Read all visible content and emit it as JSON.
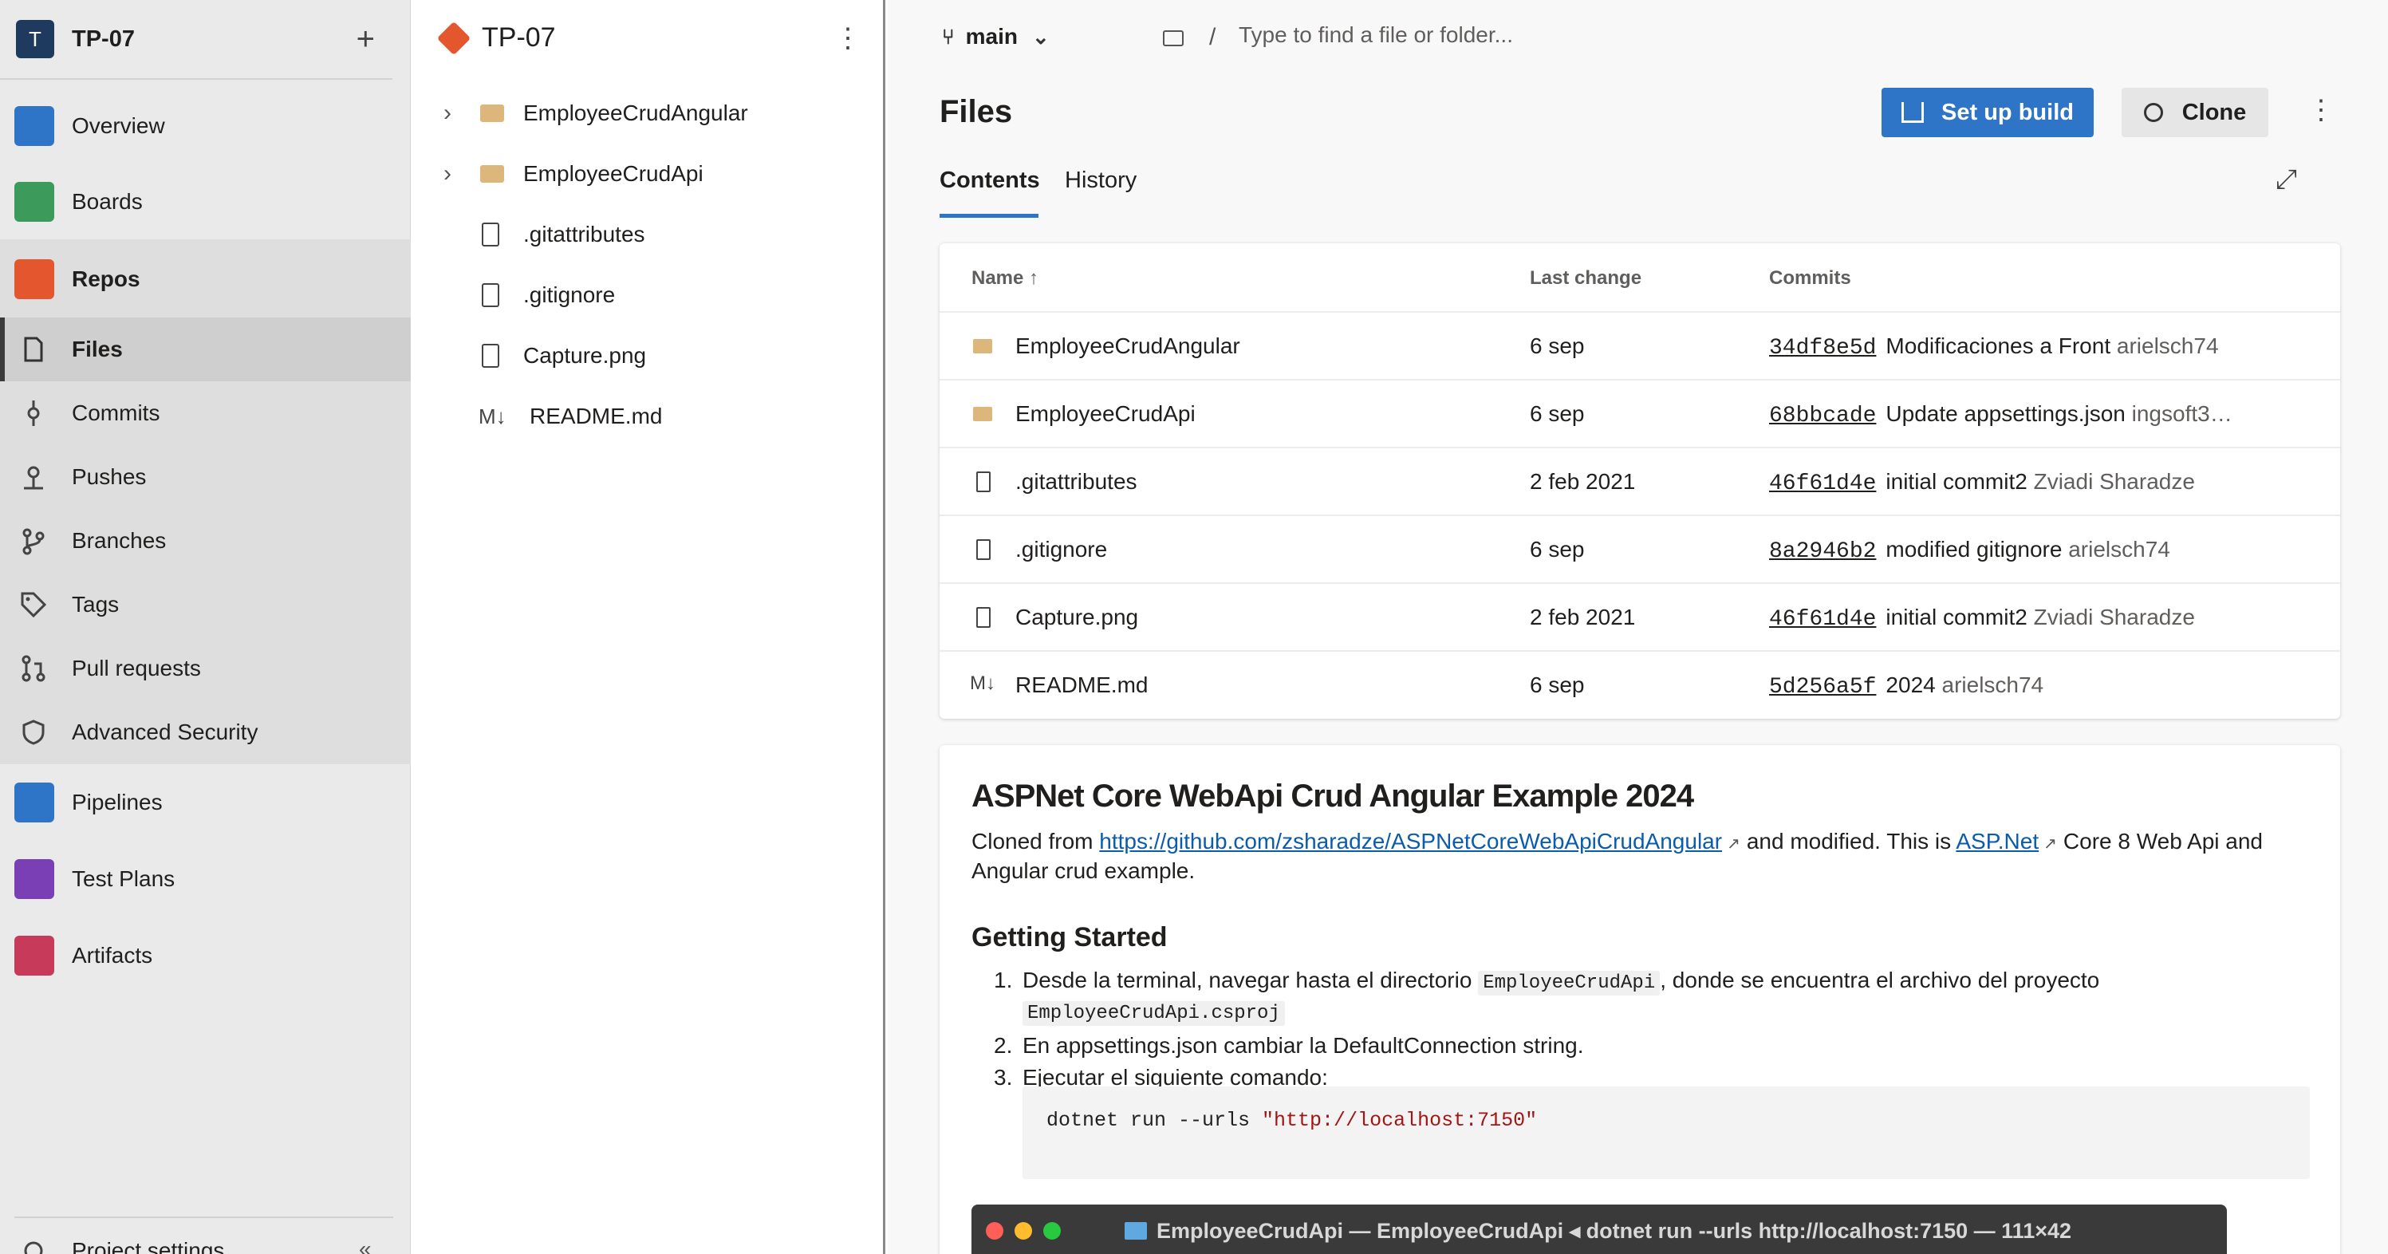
{
  "project": {
    "initial": "T",
    "name": "TP-07"
  },
  "nav": {
    "items": [
      {
        "label": "Overview"
      },
      {
        "label": "Boards"
      },
      {
        "label": "Repos"
      },
      {
        "label": "Files"
      },
      {
        "label": "Commits"
      },
      {
        "label": "Pushes"
      },
      {
        "label": "Branches"
      },
      {
        "label": "Tags"
      },
      {
        "label": "Pull requests"
      },
      {
        "label": "Advanced Security"
      },
      {
        "label": "Pipelines"
      },
      {
        "label": "Test Plans"
      },
      {
        "label": "Artifacts"
      }
    ],
    "footer": "Project settings",
    "colors": {
      "overview": "#2f75c7",
      "boards": "#3c9b5a",
      "repos": "#e4572e",
      "pipelines": "#2f75c7",
      "testplans": "#7a3fb5",
      "artifacts": "#c73a5a"
    }
  },
  "tree": {
    "repo_name": "TP-07",
    "items": [
      {
        "label": "EmployeeCrudAngular",
        "type": "folder"
      },
      {
        "label": "EmployeeCrudApi",
        "type": "folder"
      },
      {
        "label": ".gitattributes",
        "type": "file"
      },
      {
        "label": ".gitignore",
        "type": "file"
      },
      {
        "label": "Capture.png",
        "type": "file"
      },
      {
        "label": "README.md",
        "type": "markdown"
      }
    ]
  },
  "topbar": {
    "branch": "main",
    "path_placeholder": "Type to find a file or folder..."
  },
  "files": {
    "title": "Files",
    "setup_build": "Set up build",
    "clone": "Clone",
    "tabs": [
      "Contents",
      "History"
    ],
    "columns": {
      "name": "Name ↑",
      "last_change": "Last change",
      "commits": "Commits"
    },
    "rows": [
      {
        "name": "EmployeeCrudAngular",
        "type": "folder",
        "last_change": "6 sep",
        "commit": "34df8e5d",
        "message": "Modificaciones a Front",
        "author": "arielsch74"
      },
      {
        "name": "EmployeeCrudApi",
        "type": "folder",
        "last_change": "6 sep",
        "commit": "68bbcade",
        "message": "Update appsettings.json",
        "author": "ingsoft3…"
      },
      {
        "name": ".gitattributes",
        "type": "file",
        "last_change": "2 feb 2021",
        "commit": "46f61d4e",
        "message": "initial commit2",
        "author": "Zviadi Sharadze"
      },
      {
        "name": ".gitignore",
        "type": "file",
        "last_change": "6 sep",
        "commit": "8a2946b2",
        "message": "modified gitignore",
        "author": "arielsch74"
      },
      {
        "name": "Capture.png",
        "type": "file",
        "last_change": "2 feb 2021",
        "commit": "46f61d4e",
        "message": "initial commit2",
        "author": "Zviadi Sharadze"
      },
      {
        "name": "README.md",
        "type": "markdown",
        "last_change": "6 sep",
        "commit": "5d256a5f",
        "message": "2024",
        "author": "arielsch74"
      }
    ]
  },
  "readme": {
    "h1": "ASPNet Core WebApi Crud Angular Example 2024",
    "p_prefix": "Cloned from",
    "link1": "https://github.com/zsharadze/ASPNetCoreWebApiCrudAngular",
    "p_mid": "and modified. This is",
    "link2": "ASP.Net",
    "p_suffix": "Core 8 Web Api and Angular crud example.",
    "h2": "Getting Started",
    "steps": {
      "s1_a": "Desde la terminal, navegar hasta el directorio",
      "s1_code1": "EmployeeCrudApi",
      "s1_b": ", donde se encuentra el archivo del proyecto",
      "s1_code2": "EmployeeCrudApi.csproj",
      "s2": "En appsettings.json cambiar la DefaultConnection string.",
      "s3": "Ejecutar el siguiente comando:"
    },
    "code_cmd": "dotnet run --urls ",
    "code_str": "\"http://localhost:7150\"",
    "terminal_title": "EmployeeCrudApi — EmployeeCrudApi ◂ dotnet run --urls http://localhost:7150 — 111×42"
  }
}
